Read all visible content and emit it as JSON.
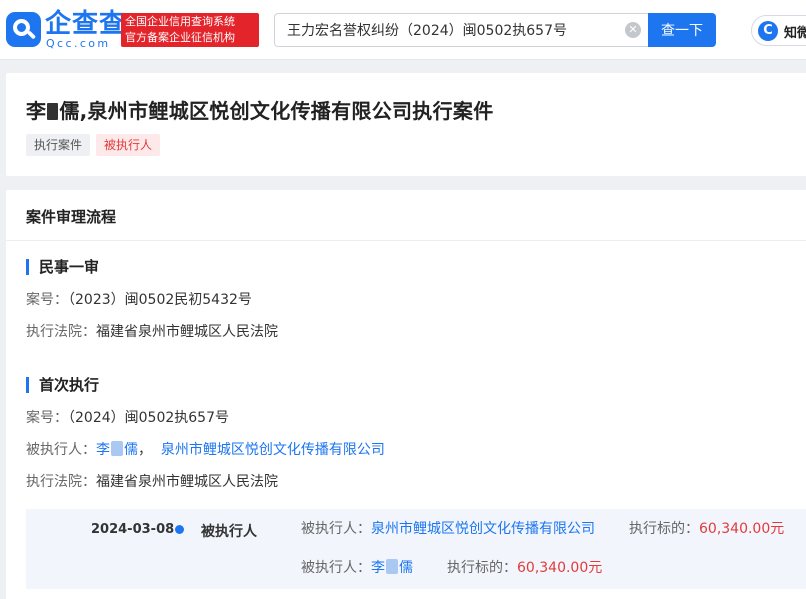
{
  "header": {
    "logo_text": "企查查",
    "logo_sub": "Qcc.com",
    "slogan_line1": "全国企业信用查询系统",
    "slogan_line2": "官方备案企业征信机构",
    "search_value": "王力宏名誉权纠纷（2024）闽0502执657号",
    "search_button": "查一下",
    "know_icon_text": "C",
    "know_label": "知微"
  },
  "title_card": {
    "title_part1": "李",
    "title_part2": "儒,泉州市鲤城区悦创文化传播有限公司执行案件",
    "tags": [
      "执行案件",
      "被执行人"
    ]
  },
  "flow": {
    "card_title": "案件审理流程",
    "stages": [
      {
        "title": "民事一审",
        "case_label": "案号：",
        "case_no": "（2023）闽0502民初5432号",
        "court_label": "执行法院：",
        "court": "福建省泉州市鲤城区人民法院"
      },
      {
        "title": "首次执行",
        "case_label": "案号：",
        "case_no": "（2024）闽0502执657号",
        "party_label": "被执行人：",
        "party_person_a": "李",
        "party_person_b": "儒",
        "party_sep": "，",
        "party_company": "泉州市鲤城区悦创文化传播有限公司",
        "court_label": "执行法院：",
        "court": "福建省泉州市鲤城区人民法院"
      }
    ],
    "timeline": {
      "date": "2024-03-08",
      "role": "被执行人",
      "rows": [
        {
          "party_label": "被执行人：",
          "party": "泉州市鲤城区悦创文化传播有限公司",
          "amount_label": "执行标的：",
          "amount": "60,340.00元"
        },
        {
          "party_label": "被执行人：",
          "party_a": "李",
          "party_b": "儒",
          "amount_label": "执行标的：",
          "amount": "60,340.00元"
        }
      ]
    }
  },
  "colors": {
    "brand": "#1d76f0",
    "slogan_bg": "#e4242b",
    "amount": "#e23b3b",
    "tag_red_bg": "#fde9e9"
  }
}
